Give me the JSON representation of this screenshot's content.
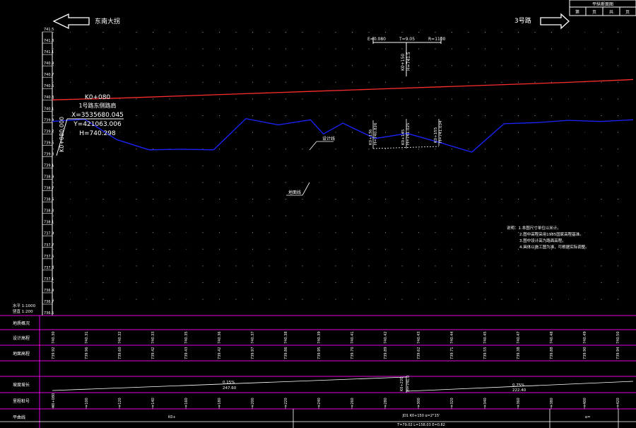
{
  "nav": {
    "left_label": "东南大拐",
    "right_label": "3号路",
    "title_block": {
      "header": "平纵断面图",
      "cells": [
        "第",
        "页",
        "共",
        "页"
      ]
    }
  },
  "station_note": {
    "lines": [
      "K0+080",
      "1号路东侧路肩",
      "X=3535680.045",
      "Y=421063.006",
      "H=740.298"
    ],
    "vertical_label": "K0+080.000"
  },
  "scale_note": {
    "lines": [
      "水平 1:1000",
      "竖直 1:200"
    ]
  },
  "labels": {
    "design_line": "设计线",
    "ground_line": "地面线"
  },
  "curve_top": {
    "labels": [
      "E=0.080",
      "T=9.05",
      "R=1100"
    ],
    "vertical": [
      "K0+150",
      "H=741.5"
    ]
  },
  "curve_marks": [
    {
      "sub": [
        "K0+136",
        "H=740.826"
      ]
    },
    {
      "sub": [
        "K0+145",
        "H=741.025"
      ]
    },
    {
      "sub": [
        "K0+155",
        "H=741.034"
      ]
    }
  ],
  "notes": {
    "title": "说明：1.本图尺寸单位以米计。",
    "items": [
      "2.图中高程采用1985国家高程基准。",
      "3.图中设计高为路面高程。",
      "4.具体以施工图为准，可根据实际调整。"
    ]
  },
  "chart_data": {
    "type": "line",
    "ylim": [
      736.5,
      741.5
    ],
    "y_ticks": [
      "736.5",
      "736.7",
      "736.9",
      "737.1",
      "737.3",
      "737.5",
      "737.7",
      "737.9",
      "738.1",
      "738.3",
      "738.5",
      "738.7",
      "738.9",
      "739.1",
      "739.3",
      "739.5",
      "739.7",
      "739.9",
      "740.1",
      "740.3",
      "740.5",
      "740.7",
      "740.9",
      "741.1",
      "741.3",
      "741.5"
    ],
    "series": [
      {
        "name": "设计线",
        "color": "#ff2d2d",
        "x": [
          0,
          100,
          200,
          300,
          400,
          500,
          600,
          700,
          800,
          900
        ],
        "values": [
          740.3,
          740.33,
          740.37,
          740.41,
          740.45,
          740.49,
          740.53,
          740.57,
          740.61,
          740.66
        ]
      },
      {
        "name": "地面线",
        "color": "#1a24ff",
        "x": [
          0,
          50,
          100,
          150,
          200,
          250,
          300,
          350,
          400,
          420,
          450,
          500,
          550,
          600,
          650,
          700,
          750,
          800,
          850,
          900
        ],
        "values": [
          739.92,
          739.96,
          739.6,
          739.42,
          739.43,
          739.42,
          739.97,
          739.86,
          739.95,
          739.7,
          739.89,
          739.62,
          739.71,
          739.55,
          739.38,
          739.88,
          739.9,
          739.94,
          739.92,
          739.95
        ]
      }
    ]
  },
  "table": {
    "row_labels": [
      "地质概况",
      "设计高程",
      "地面高程",
      "坡度坡长",
      "里程桩号",
      "平曲线"
    ],
    "col_x": [
      75,
      122,
      169,
      216,
      263,
      310,
      357,
      404,
      451,
      498,
      545,
      592,
      639,
      686,
      733,
      780,
      827,
      874
    ],
    "design": [
      "740.30",
      "740.31",
      "740.32",
      "740.33",
      "740.35",
      "740.36",
      "740.37",
      "740.38",
      "740.39",
      "740.41",
      "740.42",
      "740.43",
      "740.44",
      "740.45",
      "740.47",
      "740.48",
      "740.49",
      "740.50"
    ],
    "ground": [
      "739.92",
      "739.96",
      "739.60",
      "739.42",
      "739.43",
      "739.42",
      "739.97",
      "739.86",
      "739.95",
      "739.70",
      "739.89",
      "739.62",
      "739.71",
      "739.55",
      "739.38",
      "739.88",
      "739.90",
      "739.94"
    ],
    "stations": [
      "K0+080",
      "+100",
      "+120",
      "+140",
      "+160",
      "+180",
      "+200",
      "+220",
      "+240",
      "+260",
      "+280",
      "+300",
      "+320",
      "+340",
      "+360",
      "+380",
      "+400",
      "+420"
    ],
    "grade": [
      {
        "text": [
          "0.15%",
          "247.60"
        ]
      },
      {
        "text": [
          "0.75%",
          "222.40"
        ]
      }
    ],
    "grade_mid": [
      "K0+220",
      "H=741.0"
    ],
    "curve_cells": [
      "K0+",
      "JD1 K0+150 α=2°15'",
      "T=79.02 L=158.03 E=0.82",
      "α="
    ]
  }
}
